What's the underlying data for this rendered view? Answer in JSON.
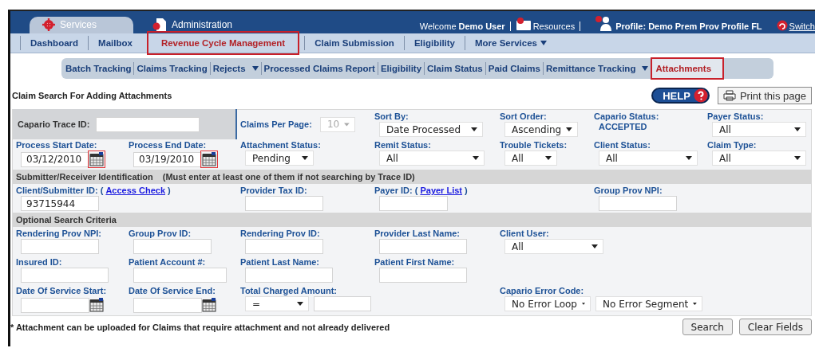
{
  "top_tabs": [
    {
      "label": "Services",
      "selected": true
    },
    {
      "label": "Administration",
      "selected": false
    }
  ],
  "header": {
    "welcome": "Welcome **Demo User**",
    "resources": "Resources",
    "profile": "Profile: Demo Prem Prov Profile FL",
    "switch": "Switch"
  },
  "nav": [
    {
      "label": "Dashboard",
      "selected": false,
      "has_menu": false
    },
    {
      "label": "Mailbox",
      "selected": false,
      "has_menu": false
    },
    {
      "label": "Revenue Cycle Management",
      "selected": true,
      "has_menu": false
    },
    {
      "label": "Claim Submission",
      "selected": false,
      "has_menu": false
    },
    {
      "label": "Eligibility",
      "selected": false,
      "has_menu": false
    },
    {
      "label": "More Services",
      "selected": false,
      "has_menu": true
    }
  ],
  "subnav": [
    {
      "label": "Batch Tracking",
      "selected": false,
      "has_menu": false
    },
    {
      "label": "Claims Tracking",
      "selected": false,
      "has_menu": false
    },
    {
      "label": "Rejects",
      "selected": false,
      "has_menu": true
    },
    {
      "label": "Processed Claims Report",
      "selected": false,
      "has_menu": false
    },
    {
      "label": "Eligibility",
      "selected": false,
      "has_menu": false
    },
    {
      "label": "Claim Status",
      "selected": false,
      "has_menu": false
    },
    {
      "label": "Paid Claims",
      "selected": false,
      "has_menu": false
    },
    {
      "label": "Remittance Tracking",
      "selected": false,
      "has_menu": true
    },
    {
      "label": "Attachments",
      "selected": true,
      "has_menu": false
    }
  ],
  "page_title": "Claim Search For Adding Attachments",
  "help_button": "HELP",
  "print_button": "Print this page",
  "form": [
    {
      "kind": "fields",
      "fields": [
        {
          "kind": "inline-text",
          "label": "Capario Trace ID:"
        },
        {
          "kind": "inline-select",
          "label": "Claims Per Page:",
          "value": "10",
          "disabled": true
        },
        {
          "kind": "select",
          "label": "Sort By:",
          "value": "Date Processed"
        },
        {
          "kind": "select",
          "label": "Sort Order:",
          "value": "Ascending"
        },
        {
          "kind": "static",
          "label": "Capario Status:",
          "value": "ACCEPTED"
        },
        {
          "kind": "select",
          "label": "Payer Status:",
          "value": "All"
        }
      ]
    },
    {
      "kind": "fields",
      "fields": [
        {
          "kind": "date",
          "label": "Process Start Date:",
          "value": "03/12/2010",
          "highlighted": true
        },
        {
          "kind": "date",
          "label": "Process End Date:",
          "value": "03/19/2010",
          "highlighted": true
        },
        {
          "kind": "select",
          "label": "Attachment Status:",
          "value": "Pending"
        },
        {
          "kind": "select",
          "label": "Remit Status:",
          "value": "All"
        },
        {
          "kind": "select",
          "label": "Trouble Tickets:",
          "value": "All"
        },
        {
          "kind": "select",
          "label": "Client Status:",
          "value": "All"
        },
        {
          "kind": "select",
          "label": "Claim Type:",
          "value": "All"
        }
      ]
    },
    {
      "kind": "header",
      "title": "Submitter/Receiver Identification",
      "note": "(Must enter at least one of them if not searching by Trace ID)"
    },
    {
      "kind": "fields",
      "fields": [
        {
          "kind": "text",
          "label": "Client/Submitter ID: (",
          "link": "Access Check",
          "label_after": ")",
          "value": "93715944"
        },
        {
          "kind": "text",
          "label": "Provider Tax ID:"
        },
        {
          "kind": "text",
          "label": "Payer ID: (",
          "link": "Payer List",
          "label_after": ")"
        },
        {
          "kind": "text",
          "label": "Group Prov NPI:"
        }
      ]
    },
    {
      "kind": "header",
      "title": "Optional Search Criteria"
    },
    {
      "kind": "fields",
      "fields": [
        {
          "kind": "text",
          "label": "Rendering Prov NPI:"
        },
        {
          "kind": "text",
          "label": "Group Prov ID:"
        },
        {
          "kind": "text",
          "label": "Rendering Prov ID:"
        },
        {
          "kind": "text",
          "label": "Provider Last Name:"
        },
        {
          "kind": "select",
          "label": "Client User:",
          "value": "All"
        }
      ]
    },
    {
      "kind": "fields",
      "fields": [
        {
          "kind": "text",
          "label": "Insured ID:"
        },
        {
          "kind": "text",
          "label": "Patient Account #:"
        },
        {
          "kind": "text",
          "label": "Patient Last Name:"
        },
        {
          "kind": "text",
          "label": "Patient First Name:"
        }
      ]
    },
    {
      "kind": "fields",
      "fields": [
        {
          "kind": "date",
          "label": "Date Of Service Start:",
          "highlighted": false
        },
        {
          "kind": "date",
          "label": "Date Of Service End:",
          "highlighted": false
        },
        {
          "kind": "amount",
          "label": "Total Charged Amount:",
          "operator": "="
        },
        {
          "kind": "select-pair",
          "label": "Capario Error Code:",
          "values": [
            "No Error Loop",
            "No Error Segment"
          ]
        }
      ]
    }
  ],
  "footnote": "* Attachment can be uploaded for Claims that require attachment and not already delivered",
  "buttons": [
    "Search",
    "Clear Fields"
  ]
}
